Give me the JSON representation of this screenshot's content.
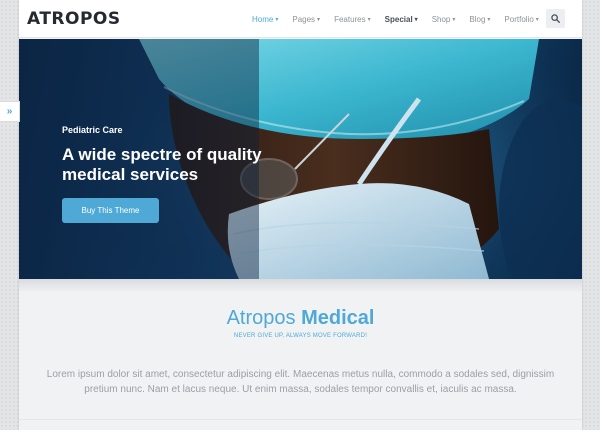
{
  "header": {
    "logo": "ATROPOS",
    "nav": [
      {
        "label": "Home",
        "state": "active"
      },
      {
        "label": "Pages",
        "state": "normal"
      },
      {
        "label": "Features",
        "state": "normal"
      },
      {
        "label": "Special",
        "state": "bold"
      },
      {
        "label": "Shop",
        "state": "normal"
      },
      {
        "label": "Blog",
        "state": "normal"
      },
      {
        "label": "Portfolio",
        "state": "normal"
      }
    ],
    "search_icon": "search-icon"
  },
  "hero": {
    "subtitle": "Pediatric Care",
    "title": "A wide spectre of quality medical services",
    "button": "Buy This Theme"
  },
  "side_tab_icon": "double-chevron-right-icon",
  "side_tab_glyph": "»",
  "intro": {
    "title_light": "Atropos",
    "title_bold": "Medical",
    "tagline": "NEVER GIVE UP, ALWAYS MOVE FORWARD!",
    "text": "Lorem ipsum dolor sit amet, consectetur adipiscing elit. Maecenas metus nulla, commodo a sodales sed, dignissim pretium nunc. Nam et lacus neque. Ut enim massa, sodales tempor convallis et, iaculis ac massa."
  },
  "colors": {
    "accent": "#4fa9d6",
    "header_bg": "#ffffff",
    "page_bg": "#f1f2f4",
    "text_dark": "#262a30",
    "text_muted": "#9aa0a6"
  }
}
